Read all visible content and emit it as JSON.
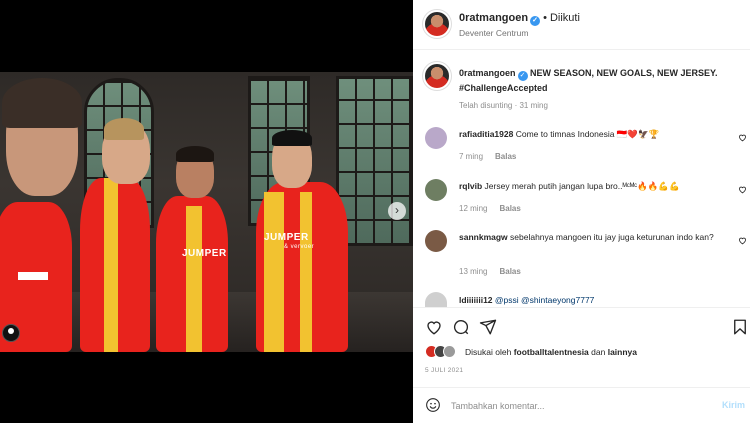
{
  "header": {
    "username": "0ratmangoen",
    "verified_mark": "✓",
    "separator": "•",
    "follow_status": "Diikuti",
    "location": "Deventer Centrum"
  },
  "caption": {
    "username": "0ratmangoen",
    "verified_mark": "✓",
    "text": "NEW SEASON, NEW GOALS, NEW JERSEY. #ChallengeAccepted",
    "time": "Telah disunting · 31 ming"
  },
  "photo": {
    "jersey_sponsor": "JUMPER",
    "jersey_sponsor_sub": "& vervoer",
    "next_icon": "›"
  },
  "comments": [
    {
      "username": "rafiaditia1928",
      "text": "Come to timnas Indonesia 🇮🇩❤️🦅🏆",
      "time": "7 ming",
      "reply": "Balas",
      "avatar_color": "#b9a8c9"
    },
    {
      "username": "rqlvib",
      "text": "Jersey merah putih jangan lupa bro..ᴹᶜᴹᶜ🔥🔥💪💪",
      "time": "12 ming",
      "reply": "Balas",
      "avatar_color": "#6e7e62"
    },
    {
      "username": "sannkmagw",
      "text": "sebelahnya mangoen itu jay juga keturunan indo kan?",
      "time": "13 ming",
      "reply": "Balas",
      "avatar_color": "#7a5a45"
    },
    {
      "username": "ldiiiiiii12",
      "text": "@pssi @shintaeyong7777",
      "avatar_color": "#cfcfcf"
    }
  ],
  "actions": {
    "like_icon": "heart-icon",
    "comment_icon": "comment-icon",
    "share_icon": "share-icon",
    "save_icon": "bookmark-icon"
  },
  "likes": {
    "prefix": "Disukai oleh",
    "user": "footballtalentnesia",
    "connector": "dan",
    "others": "lainnya"
  },
  "post_date": "5 JULI 2021",
  "add_comment": {
    "placeholder": "Tambahkan komentar...",
    "post_label": "Kirim"
  },
  "colors": {
    "accent": "#3897f0",
    "post_disabled": "#b2dffc",
    "jersey_red": "#e8231d",
    "jersey_yellow": "#f2c230"
  }
}
